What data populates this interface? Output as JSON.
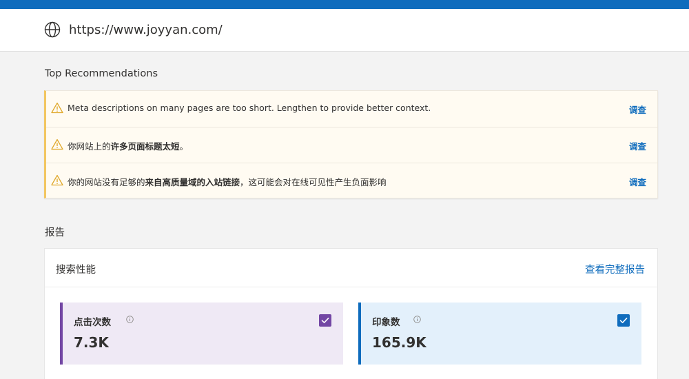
{
  "address_bar": {
    "url": "https://www.joyyan.com/",
    "icon": "globe-icon"
  },
  "recommendations": {
    "title": "Top Recommendations",
    "items": [
      {
        "text_parts": [
          {
            "text": "Meta descriptions on many pages are too short. Lengthen to provide better context.",
            "bold": false
          }
        ],
        "action": "调查"
      },
      {
        "text_parts": [
          {
            "text": "你网站上的",
            "bold": false
          },
          {
            "text": "许多页面标题太短",
            "bold": true
          },
          {
            "text": "。",
            "bold": false
          }
        ],
        "action": "调查"
      },
      {
        "text_parts": [
          {
            "text": "你的网站没有足够的",
            "bold": false
          },
          {
            "text": "来自高质量域的入站链接",
            "bold": true
          },
          {
            "text": "，这可能会对在线可见性产生负面影响",
            "bold": false
          }
        ],
        "action": "调查"
      }
    ],
    "warning_color": "#f2c661",
    "icon": "warning-icon"
  },
  "reports": {
    "title": "报告",
    "card": {
      "name": "搜索性能",
      "link": "查看完整报告",
      "metrics": [
        {
          "label": "点击次数",
          "value": "7.3K",
          "checked": true,
          "color": "#7347a4"
        },
        {
          "label": "印象数",
          "value": "165.9K",
          "checked": true,
          "color": "#0f6cbd"
        }
      ]
    }
  },
  "colors": {
    "accent": "#0f6cbd",
    "top_bar": "#0f6cbd",
    "clicks": "#7347a4",
    "impressions": "#0f6cbd"
  }
}
